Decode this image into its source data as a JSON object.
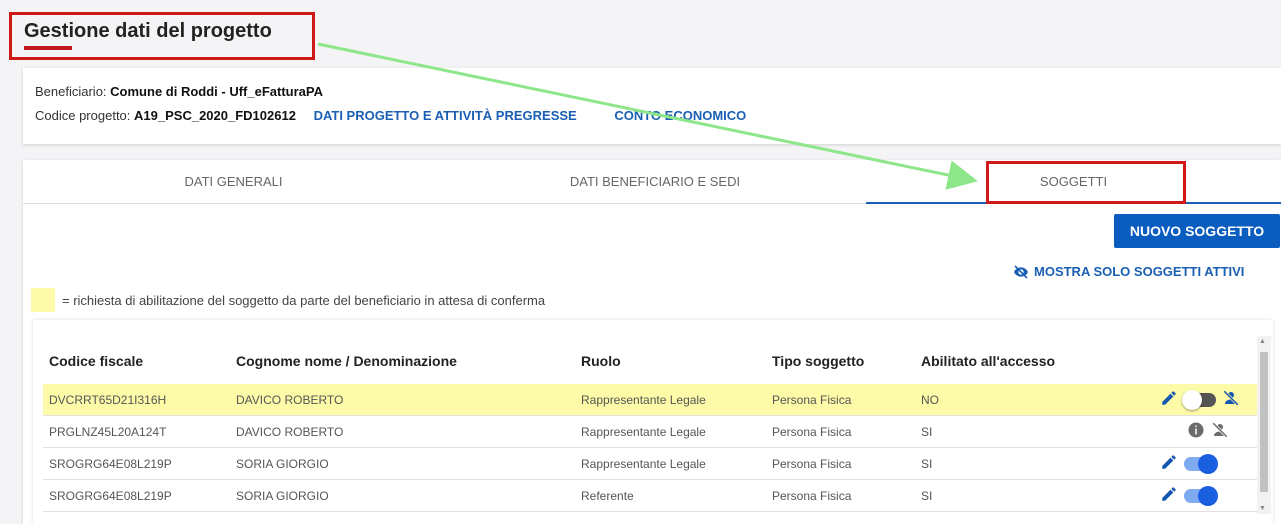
{
  "page": {
    "title": "Gestione dati del progetto"
  },
  "info": {
    "beneficiario_label": "Beneficiario:",
    "beneficiario_value": "Comune di Roddi - Uff_eFatturaPA",
    "codice_label": "Codice progetto:",
    "codice_value": "A19_PSC_2020_FD102612",
    "link_dati": "DATI PROGETTO E ATTIVITÀ PREGRESSE",
    "link_conto": "CONTO ECONOMICO"
  },
  "tabs": [
    {
      "label": "DATI GENERALI"
    },
    {
      "label": "DATI BENEFICIARIO E SEDI"
    },
    {
      "label": "SOGGETTI"
    }
  ],
  "actions": {
    "new_button": "NUOVO SOGGETTO",
    "show_active": "MOSTRA SOLO SOGGETTI ATTIVI"
  },
  "legend": {
    "text": "= richiesta di abilitazione del soggetto da parte del beneficiario in attesa di conferma"
  },
  "table": {
    "headers": [
      "Codice fiscale",
      "Cognome nome / Denominazione",
      "Ruolo",
      "Tipo soggetto",
      "Abilitato all'accesso"
    ],
    "rows": [
      {
        "codice": "DVCRRT65D21I316H",
        "nome": "DAVICO ROBERTO",
        "ruolo": "Rappresentante Legale",
        "tipo": "Persona Fisica",
        "abilitato": "NO",
        "pending": true,
        "icons": [
          "pencil-icon",
          "toggle-off",
          "user-off-icon"
        ]
      },
      {
        "codice": "PRGLNZ45L20A124T",
        "nome": "DAVICO ROBERTO",
        "ruolo": "Rappresentante Legale",
        "tipo": "Persona Fisica",
        "abilitato": "SI",
        "pending": false,
        "icons": [
          "info-icon",
          "user-off-icon"
        ]
      },
      {
        "codice": "SROGRG64E08L219P",
        "nome": "SORIA GIORGIO",
        "ruolo": "Rappresentante Legale",
        "tipo": "Persona Fisica",
        "abilitato": "SI",
        "pending": false,
        "icons": [
          "pencil-icon",
          "toggle-on"
        ]
      },
      {
        "codice": "SROGRG64E08L219P",
        "nome": "SORIA GIORGIO",
        "ruolo": "Referente",
        "tipo": "Persona Fisica",
        "abilitato": "SI",
        "pending": false,
        "icons": [
          "pencil-icon",
          "toggle-on"
        ]
      }
    ]
  },
  "colors": {
    "accent": "#1a5fb4",
    "button": "#0b5cbf",
    "pending_row": "#fdfaa8",
    "annotation_box": "#d01818",
    "annotation_arrow": "#8ee68a"
  }
}
